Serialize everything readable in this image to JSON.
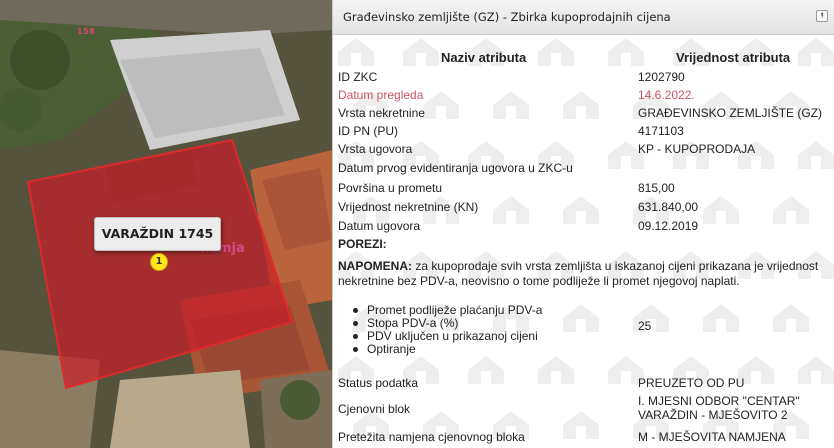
{
  "map": {
    "parcel_number": "158",
    "tooltip_text": "VARAŽDIN 1745",
    "ghost_label_line1": "ka",
    "ghost_label_line2": "namja",
    "marker_number": "1"
  },
  "panel": {
    "title": "Građevinsko zemljište (GZ) - Zbirka kupoprodajnih cijena",
    "collapse_icon": "double-chevron-up-icon",
    "col_name": "Naziv atributa",
    "col_value": "Vrijednost atributa",
    "rows": [
      {
        "name": "ID ZKC",
        "value": "1202790"
      },
      {
        "name": "Datum pregleda",
        "value": "14.6.2022."
      },
      {
        "name": "Vrsta nekretnine",
        "value": "GRAĐEVINSKO ZEMLJIŠTE (GZ)"
      },
      {
        "name": "ID PN (PU)",
        "value": "4171103"
      },
      {
        "name": "Vrsta ugovora",
        "value": "KP - KUPOPRODAJA"
      },
      {
        "name": "Datum prvog evidentiranja ugovora u ZKC-u",
        "value": ""
      },
      {
        "name": "Površina u prometu",
        "value": "815,00"
      },
      {
        "name": "Vrijednost nekretnine (KN)",
        "value": "631.840,00"
      },
      {
        "name": "Datum ugovora",
        "value": "09.12.2019"
      }
    ],
    "porezi": "POREZI:",
    "note_label": "NAPOMENA:",
    "note_text": " za kupoprodaje svih vrsta zemljišta u iskazanoj cijeni prikazana je vrijednost nekretnine bez PDV-a, neovisno o tome podliježe li promet njegovoj naplati.",
    "bullets": [
      "Promet podliježe plaćanju PDV-a",
      "Stopa PDV-a (%)",
      "PDV uključen u prikazanoj cijeni",
      "Optiranje"
    ],
    "vat_rate": "25",
    "bottom_rows": {
      "status_name": "Status podatka",
      "status_value": "PREUZETO OD PU",
      "block_name": "Cjenovni blok",
      "block_value_1": "I. MJESNI ODBOR \"CENTAR\"",
      "block_value_2": "VARAŽDIN - MJEŠOVITO 2",
      "purpose_name": "Pretežita namjena cjenovnog bloka",
      "purpose_value": "M - MJEŠOVITA NAMJENA"
    },
    "colors": {
      "date_red": "#c7556b",
      "parcel_fill": "#c81e28"
    }
  }
}
